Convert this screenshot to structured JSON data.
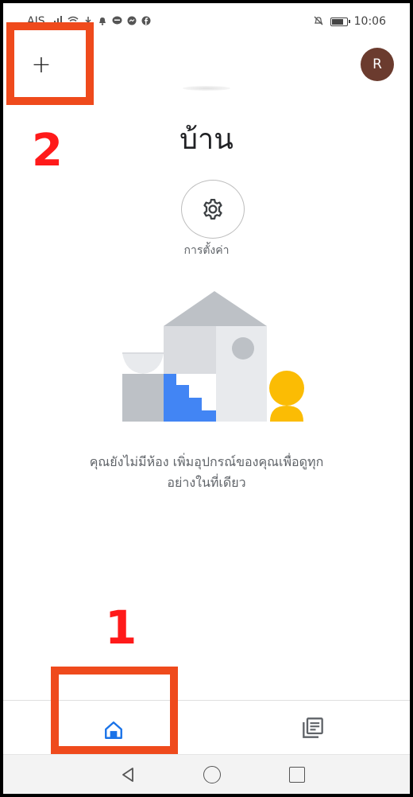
{
  "status_bar": {
    "carrier": "AIS",
    "time": "10:06",
    "left_icons": [
      "signal-icon",
      "wifi-icon",
      "download-icon",
      "notification-icon",
      "line-icon",
      "messenger-icon",
      "facebook-icon"
    ],
    "right_icons": [
      "mute-icon",
      "battery-icon"
    ]
  },
  "top_bar": {
    "add_label": "+",
    "avatar_initial": "R"
  },
  "home": {
    "title": "บ้าน",
    "settings_label": "การตั้งค่า",
    "empty_message_line1": "คุณยังไม่มีห้อง เพิ่มอุปกรณ์ของคุณเพื่อดูทุก",
    "empty_message_line2": "อย่างในที่เดียว"
  },
  "annotations": {
    "label_1": "1",
    "label_2": "2",
    "color": "#ef4a1c",
    "number_color": "#ff1a1a"
  },
  "bottom_nav": {
    "items": [
      "home-icon",
      "feed-icon"
    ],
    "active_color": "#1a73e8"
  },
  "system_nav": {
    "items": [
      "back-icon",
      "home-circle-icon",
      "recents-icon"
    ]
  }
}
